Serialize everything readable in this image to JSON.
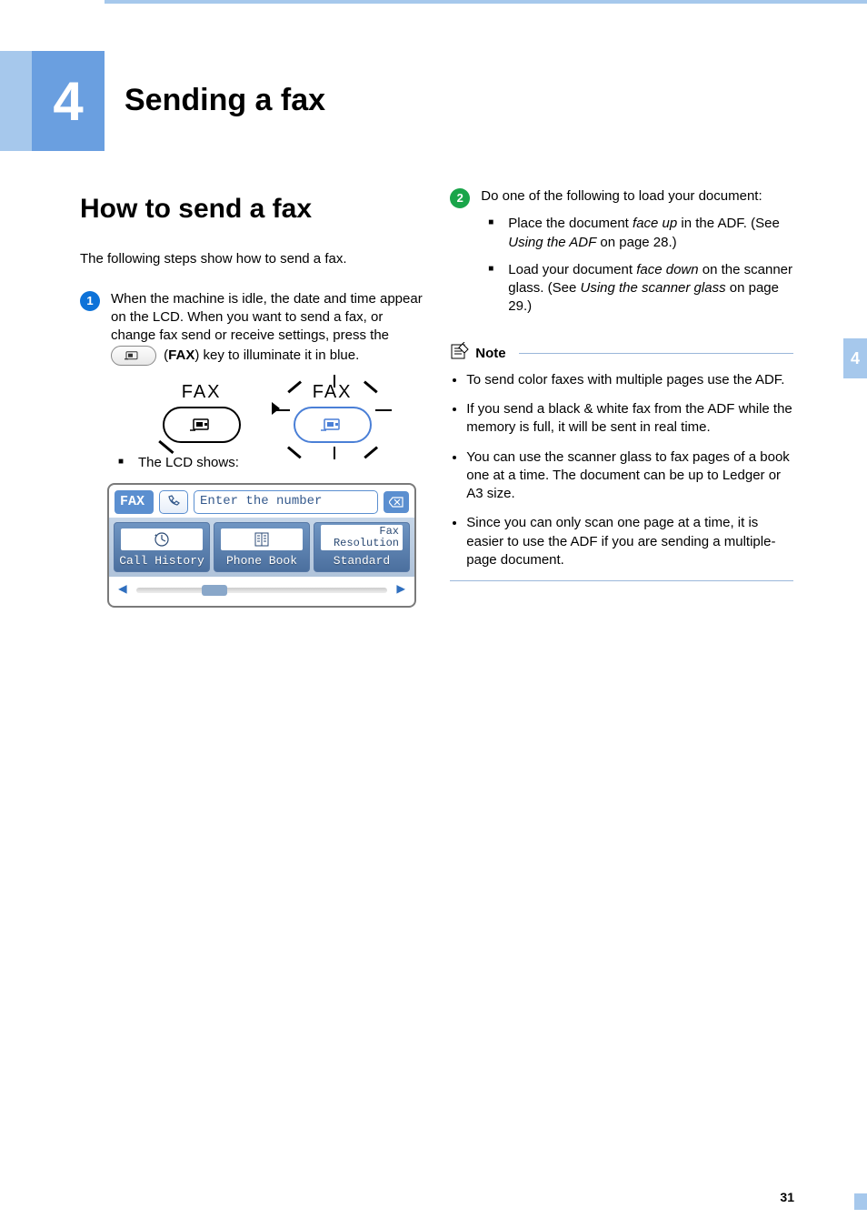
{
  "chapter": {
    "number": "4",
    "title": "Sending a fax"
  },
  "side_tab": "4",
  "section_heading": "How to send a fax",
  "intro_text": "The following steps show how to send a fax.",
  "step1": {
    "badge": "1",
    "text_a": "When the machine is idle, the date and time appear on the LCD. When you want to send a fax, or change fax send or receive settings, press the",
    "text_b_open": " (",
    "text_b_bold": "FAX",
    "text_b_close": ") key to illuminate it in blue.",
    "lcd_shows": "The LCD shows:"
  },
  "fax_illustration": {
    "label_left": "FAX",
    "label_right": "FAX"
  },
  "lcd": {
    "tag": "FAX",
    "entry_placeholder": "Enter the number",
    "call_history": "Call History",
    "phone_book": "Phone Book",
    "fax_res_top": "Fax\nResolution",
    "fax_res_bottom": "Standard"
  },
  "step2": {
    "badge": "2",
    "intro": "Do one of the following to load your document:",
    "bullets": [
      {
        "pre": "Place the document ",
        "ital": "face up",
        "mid": " in the ADF. (See ",
        "ref": "Using the ADF",
        "post": " on page 28.)"
      },
      {
        "pre": "Load your document ",
        "ital": "face down",
        "mid": " on the scanner glass. (See ",
        "ref": "Using the scanner glass",
        "post": " on page 29.)"
      }
    ]
  },
  "note": {
    "label": "Note",
    "items": [
      "To send color faxes with multiple pages use the ADF.",
      "If you send a black & white fax from the ADF while the memory is full, it will be sent in real time.",
      "You can use the scanner glass to fax pages of a book one at a time. The document can be up to Ledger or A3 size.",
      "Since you can only scan one page at a time, it is easier to use the ADF if you are sending a multiple-page document."
    ]
  },
  "page_number": "31"
}
